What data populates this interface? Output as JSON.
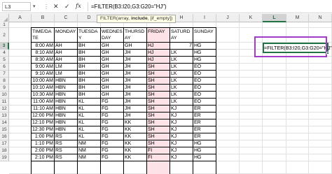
{
  "formula_bar": {
    "name_box": "L3",
    "dots": "⋮",
    "cancel": "✕",
    "enter": "✓",
    "fx": "fx",
    "formula": "=FILTER(B3:I20,G3:G20=\"HJ\")"
  },
  "tooltip": {
    "prefix": "FILTER(array, ",
    "bold": "include",
    "suffix": ", [if_empty])"
  },
  "columns": [
    "A",
    "B",
    "C",
    "D",
    "E",
    "F",
    "G",
    "H",
    "I",
    "J",
    "K",
    "L",
    "M",
    "N"
  ],
  "rows": [
    "1",
    "2",
    "3",
    "4",
    "5",
    "6",
    "7",
    "8",
    "9",
    "10",
    "11",
    "12",
    "13",
    "14",
    "15",
    "16",
    "17",
    "18",
    "19"
  ],
  "active_cell": {
    "ref": "L3",
    "text": "=FILTER(B3:I20,G3:G20=\"HJ\")"
  },
  "table": {
    "headers": [
      "TIME/DATE",
      "MONDAY",
      "TUESDAY",
      "WEDNESDAY",
      "THURSDAY",
      "FRIDAY",
      "SATURDAY",
      "SUNDAY"
    ],
    "header_display": [
      "TIME/DA\nTE",
      "MONDAY",
      "TUESDA\nY",
      "WEDNES\nDAY",
      "THURSD\nAY",
      "FRIDAY",
      "SATURD\nAY",
      "SUNDAY"
    ],
    "rows": [
      [
        "8:00 AM",
        "AH",
        "BH",
        "GH",
        "GH",
        "HJ",
        "7",
        "HG"
      ],
      [
        "8:10 AM",
        "AH",
        "BH",
        "GH",
        "JH",
        "HJ",
        "LK",
        "HG"
      ],
      [
        "8:30 AM",
        "AH",
        "BH",
        "GH",
        "JH",
        "HJ",
        "LK",
        "HG"
      ],
      [
        "9:00 AM",
        "LM",
        "BH",
        "GH",
        "JH",
        "SH",
        "LK",
        "EO"
      ],
      [
        "9:10 AM",
        "LM",
        "BH",
        "GH",
        "JH",
        "SH",
        "LK",
        "EO"
      ],
      [
        "10:00 AM",
        "HBN",
        "BH",
        "GH",
        "JH",
        "SH",
        "LK",
        "EO"
      ],
      [
        "10:10 AM",
        "HBN",
        "BH",
        "GH",
        "JH",
        "SH",
        "LK",
        "EO"
      ],
      [
        "10:30 AM",
        "HBN",
        "BH",
        "GH",
        "JH",
        "SH",
        "LK",
        "EO"
      ],
      [
        "11:00 AM",
        "HBN",
        "KL",
        "FG",
        "JH",
        "SH",
        "LK",
        "EO"
      ],
      [
        "11:10 AM",
        "HBN",
        "KL",
        "FG",
        "JH",
        "SH",
        "KJ",
        "ER"
      ],
      [
        "12:00 PM",
        "HBN",
        "KL",
        "FG",
        "JH",
        "SH",
        "KJ",
        "ER"
      ],
      [
        "12:10 PM",
        "HBN",
        "KL",
        "FG",
        "KK",
        "SH",
        "KJ",
        "ER"
      ],
      [
        "12:30 PM",
        "HBN",
        "KL",
        "FG",
        "KK",
        "SH",
        "KJ",
        "ER"
      ],
      [
        "1:00 PM",
        "RS",
        "KL",
        "FG",
        "KK",
        "SH",
        "KJ",
        "ER"
      ],
      [
        "1:10 PM",
        "RS",
        "NM",
        "FG",
        "KK",
        "SH",
        "KJ",
        "HG"
      ],
      [
        "2:00 PM",
        "RS",
        "NM",
        "FG",
        "KK",
        "FI",
        "KJ",
        "HG"
      ],
      [
        "2:10 PM",
        "RS",
        "NM",
        "FG",
        "KK",
        "FI",
        "KJ",
        "HG"
      ]
    ]
  },
  "colors": {
    "excel_green": "#217346",
    "highlight_purple": "#a23cc8",
    "friday_fill": "#fde3e8",
    "header_bg": "#efefef"
  }
}
